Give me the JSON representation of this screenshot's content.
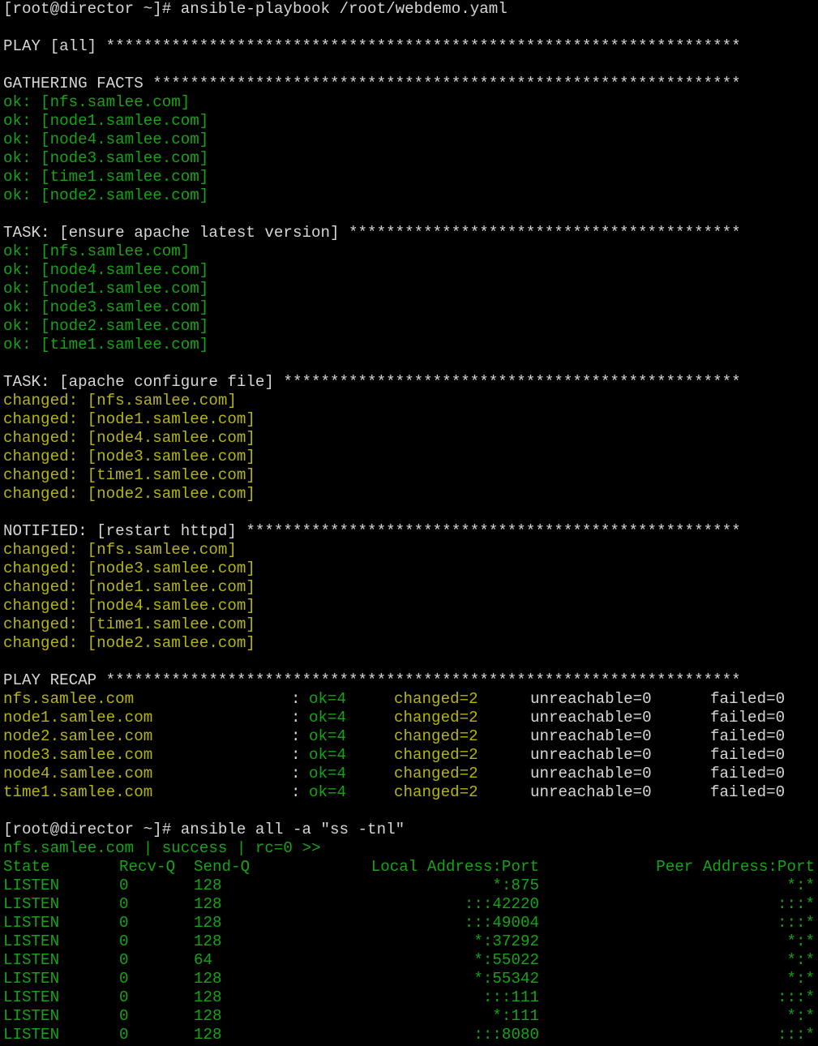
{
  "colors": {
    "white": "#d6d6d6",
    "green": "#17a317",
    "yellow": "#b5b50f",
    "background": "#000000"
  },
  "lines": [
    {
      "type": "text",
      "color": "w",
      "text": "[root@director ~]# ansible-playbook /root/webdemo.yaml"
    },
    {
      "type": "blank"
    },
    {
      "type": "text",
      "color": "w",
      "text": "PLAY [all] ********************************************************************"
    },
    {
      "type": "blank"
    },
    {
      "type": "text",
      "color": "w",
      "text": "GATHERING FACTS ***************************************************************"
    },
    {
      "type": "text",
      "color": "g",
      "text": "ok: [nfs.samlee.com]"
    },
    {
      "type": "text",
      "color": "g",
      "text": "ok: [node1.samlee.com]"
    },
    {
      "type": "text",
      "color": "g",
      "text": "ok: [node4.samlee.com]"
    },
    {
      "type": "text",
      "color": "g",
      "text": "ok: [node3.samlee.com]"
    },
    {
      "type": "text",
      "color": "g",
      "text": "ok: [time1.samlee.com]"
    },
    {
      "type": "text",
      "color": "g",
      "text": "ok: [node2.samlee.com]"
    },
    {
      "type": "blank"
    },
    {
      "type": "text",
      "color": "w",
      "text": "TASK: [ensure apache latest version] ******************************************"
    },
    {
      "type": "text",
      "color": "g",
      "text": "ok: [nfs.samlee.com]"
    },
    {
      "type": "text",
      "color": "g",
      "text": "ok: [node4.samlee.com]"
    },
    {
      "type": "text",
      "color": "g",
      "text": "ok: [node1.samlee.com]"
    },
    {
      "type": "text",
      "color": "g",
      "text": "ok: [node3.samlee.com]"
    },
    {
      "type": "text",
      "color": "g",
      "text": "ok: [node2.samlee.com]"
    },
    {
      "type": "text",
      "color": "g",
      "text": "ok: [time1.samlee.com]"
    },
    {
      "type": "blank"
    },
    {
      "type": "text",
      "color": "w",
      "text": "TASK: [apache configure file] *************************************************"
    },
    {
      "type": "text",
      "color": "y",
      "text": "changed: [nfs.samlee.com]"
    },
    {
      "type": "text",
      "color": "y",
      "text": "changed: [node1.samlee.com]"
    },
    {
      "type": "text",
      "color": "y",
      "text": "changed: [node4.samlee.com]"
    },
    {
      "type": "text",
      "color": "y",
      "text": "changed: [node3.samlee.com]"
    },
    {
      "type": "text",
      "color": "y",
      "text": "changed: [time1.samlee.com]"
    },
    {
      "type": "text",
      "color": "y",
      "text": "changed: [node2.samlee.com]"
    },
    {
      "type": "blank"
    },
    {
      "type": "text",
      "color": "w",
      "text": "NOTIFIED: [restart httpd] *****************************************************"
    },
    {
      "type": "text",
      "color": "y",
      "text": "changed: [nfs.samlee.com]"
    },
    {
      "type": "text",
      "color": "y",
      "text": "changed: [node3.samlee.com]"
    },
    {
      "type": "text",
      "color": "y",
      "text": "changed: [node1.samlee.com]"
    },
    {
      "type": "text",
      "color": "y",
      "text": "changed: [node4.samlee.com]"
    },
    {
      "type": "text",
      "color": "y",
      "text": "changed: [time1.samlee.com]"
    },
    {
      "type": "text",
      "color": "y",
      "text": "changed: [node2.samlee.com]"
    },
    {
      "type": "blank"
    },
    {
      "type": "text",
      "color": "w",
      "text": "PLAY RECAP ********************************************************************"
    },
    {
      "type": "recap",
      "host": "nfs.samlee.com",
      "sep": ":",
      "ok": "ok=4",
      "changed": "changed=2",
      "unreachable": "unreachable=0",
      "failed": "failed=0"
    },
    {
      "type": "recap",
      "host": "node1.samlee.com",
      "sep": ":",
      "ok": "ok=4",
      "changed": "changed=2",
      "unreachable": "unreachable=0",
      "failed": "failed=0"
    },
    {
      "type": "recap",
      "host": "node2.samlee.com",
      "sep": ":",
      "ok": "ok=4",
      "changed": "changed=2",
      "unreachable": "unreachable=0",
      "failed": "failed=0"
    },
    {
      "type": "recap",
      "host": "node3.samlee.com",
      "sep": ":",
      "ok": "ok=4",
      "changed": "changed=2",
      "unreachable": "unreachable=0",
      "failed": "failed=0"
    },
    {
      "type": "recap",
      "host": "node4.samlee.com",
      "sep": ":",
      "ok": "ok=4",
      "changed": "changed=2",
      "unreachable": "unreachable=0",
      "failed": "failed=0"
    },
    {
      "type": "recap",
      "host": "time1.samlee.com",
      "sep": ":",
      "ok": "ok=4",
      "changed": "changed=2",
      "unreachable": "unreachable=0",
      "failed": "failed=0"
    },
    {
      "type": "blank"
    },
    {
      "type": "text",
      "color": "w",
      "text": "[root@director ~]# ansible all -a \"ss -tnl\""
    },
    {
      "type": "text",
      "color": "g",
      "text": "nfs.samlee.com | success | rc=0 >>"
    },
    {
      "type": "ss",
      "state": "State",
      "recvq": "Recv-Q",
      "sendq": "Send-Q",
      "local": "Local Address:Port",
      "peer": "Peer Address:Port"
    },
    {
      "type": "ss",
      "state": "LISTEN",
      "recvq": "0",
      "sendq": "128",
      "local": "*:875",
      "peer": "*:*"
    },
    {
      "type": "ss",
      "state": "LISTEN",
      "recvq": "0",
      "sendq": "128",
      "local": ":::42220",
      "peer": ":::*"
    },
    {
      "type": "ss",
      "state": "LISTEN",
      "recvq": "0",
      "sendq": "128",
      "local": ":::49004",
      "peer": ":::*"
    },
    {
      "type": "ss",
      "state": "LISTEN",
      "recvq": "0",
      "sendq": "128",
      "local": "*:37292",
      "peer": "*:*"
    },
    {
      "type": "ss",
      "state": "LISTEN",
      "recvq": "0",
      "sendq": "64",
      "local": "*:55022",
      "peer": "*:*"
    },
    {
      "type": "ss",
      "state": "LISTEN",
      "recvq": "0",
      "sendq": "128",
      "local": "*:55342",
      "peer": "*:*"
    },
    {
      "type": "ss",
      "state": "LISTEN",
      "recvq": "0",
      "sendq": "128",
      "local": ":::111",
      "peer": ":::*"
    },
    {
      "type": "ss",
      "state": "LISTEN",
      "recvq": "0",
      "sendq": "128",
      "local": "*:111",
      "peer": "*:*"
    },
    {
      "type": "ss",
      "state": "LISTEN",
      "recvq": "0",
      "sendq": "128",
      "local": ":::8080",
      "peer": ":::*"
    }
  ]
}
